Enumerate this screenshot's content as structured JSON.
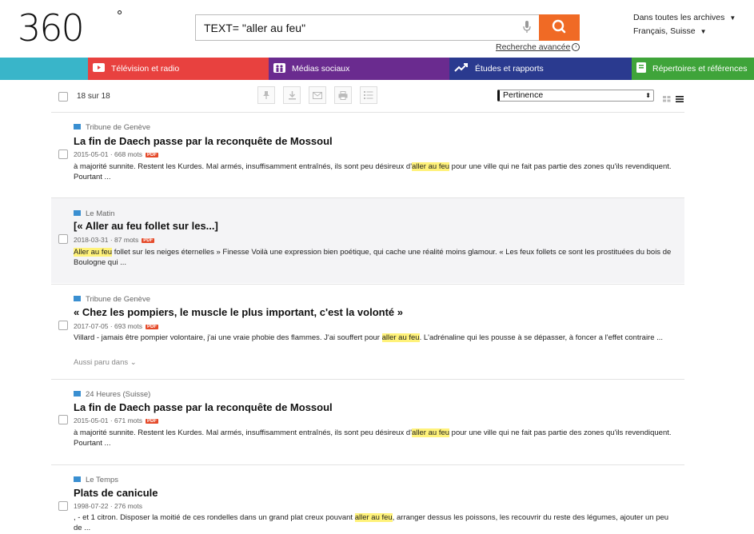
{
  "header": {
    "logo_text": "360",
    "logo_degree": "°",
    "search_value": "TEXT= \"aller au feu\"",
    "advanced_search": "Recherche avancée",
    "archive_scope": "Dans toutes les archives",
    "language": "Français, Suisse"
  },
  "nav": {
    "items": [
      {
        "label": "Télévision et radio",
        "color": "#e8413f"
      },
      {
        "label": "Médias sociaux",
        "color": "#6a2b8f"
      },
      {
        "label": "Études et rapports",
        "color": "#2a3a8f"
      },
      {
        "label": "Répertoires et références",
        "color": "#3fa43a"
      }
    ],
    "left_color": "#39b5c9"
  },
  "toolbar": {
    "count": "18 sur 18",
    "sort": "Pertinence"
  },
  "results": [
    {
      "source": "Tribune de Genève",
      "title": "La fin de Daech passe par la reconquête de Mossoul",
      "date": "2015-05-01",
      "words": "668 mots",
      "pdf": "PDF",
      "snippet_before": "à majorité sunnite. Restent les Kurdes. Mal armés, insuffisamment entraînés, ils sont peu désireux d'",
      "snippet_hl": "aller au feu",
      "snippet_after": " pour une ville qui ne fait pas partie des zones qu'ils revendiquent. Pourtant ..."
    },
    {
      "source": "Le Matin",
      "title": "[« Aller au feu follet sur les...]",
      "date": "2018-03-31",
      "words": "87 mots",
      "pdf": "PDF",
      "snippet_before": "",
      "snippet_hl": "Aller au feu",
      "snippet_after": " follet sur les neiges éternelles » Finesse Voilà une expression bien poétique, qui cache une réalité moins glamour. « Les feux follets ce sont les prostituées du bois de Boulogne qui ..."
    },
    {
      "source": "Tribune de Genève",
      "title": "« Chez les pompiers, le muscle le plus important, c'est la volonté »",
      "date": "2017-07-05",
      "words": "693 mots",
      "pdf": "PDF",
      "snippet_before": "Villard - jamais être pompier volontaire, j'ai une vraie phobie des flammes. J'ai souffert pour ",
      "snippet_hl": "aller au feu",
      "snippet_after": ". L'adrénaline qui les pousse à se dépasser, à foncer a l'effet contraire ...",
      "also": "Aussi paru dans"
    },
    {
      "source": "24 Heures (Suisse)",
      "title": "La fin de Daech passe par la reconquête de Mossoul",
      "date": "2015-05-01",
      "words": "671 mots",
      "pdf": "PDF",
      "snippet_before": "à majorité sunnite. Restent les Kurdes. Mal armés, insuffisamment entraînés, ils sont peu désireux d'",
      "snippet_hl": "aller au feu",
      "snippet_after": " pour une ville qui ne fait pas partie des zones qu'ils revendiquent. Pourtant ..."
    },
    {
      "source": "Le Temps",
      "title": "Plats de canicule",
      "date": "1998-07-22",
      "words": "276 mots",
      "snippet_before": ", - et 1 citron. Disposer la moitié de ces rondelles dans un grand plat creux pouvant ",
      "snippet_hl": "aller au feu",
      "snippet_after": ", arranger dessus les poissons, les recouvrir du reste des légumes, ajouter un peu de ..."
    }
  ]
}
